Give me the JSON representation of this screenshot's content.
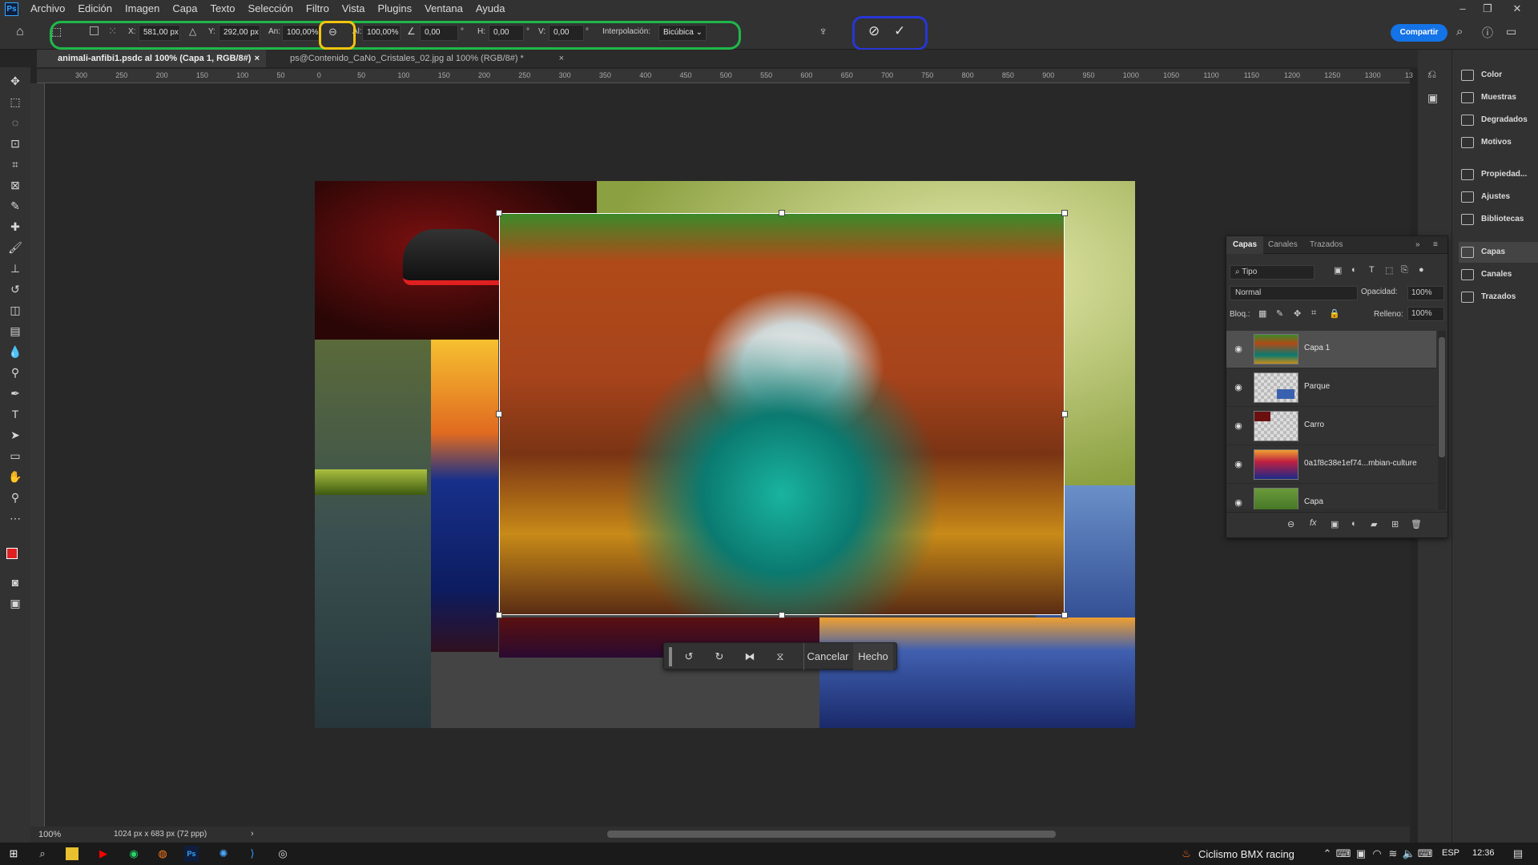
{
  "app": {
    "logo": "Ps"
  },
  "menu": [
    "Archivo",
    "Edición",
    "Imagen",
    "Capa",
    "Texto",
    "Selección",
    "Filtro",
    "Vista",
    "Plugins",
    "Ventana",
    "Ayuda"
  ],
  "options": {
    "x_label": "X:",
    "x_value": "581,00 px",
    "y_label": "Y:",
    "y_value": "292,00 px",
    "w_label": "An:",
    "w_value": "100,00%",
    "h_label": "Al:",
    "h_value": "100,00%",
    "angle_value": "0,00",
    "deg": "°",
    "hskew_label": "H:",
    "hskew_value": "0,00",
    "vskew_label": "V:",
    "vskew_value": "0,00",
    "interp_label": "Interpolación:",
    "interp_value": "Bicúbica",
    "share_label": "Compartir"
  },
  "tabs": [
    {
      "label": "animali-anfibi1.psdc al 100% (Capa 1, RGB/8#)",
      "close": "×"
    },
    {
      "label": "ps@Contenido_CaNo_Cristales_02.jpg al 100% (RGB/8#) *",
      "close": "×"
    }
  ],
  "ruler": [
    "300",
    "250",
    "200",
    "150",
    "100",
    "50",
    "0",
    "50",
    "100",
    "150",
    "200",
    "250",
    "300",
    "350",
    "400",
    "450",
    "500",
    "550",
    "600",
    "650",
    "700",
    "750",
    "800",
    "850",
    "900",
    "950",
    "1000",
    "1050",
    "1100",
    "1150",
    "1200",
    "1250",
    "1300",
    "13"
  ],
  "status": {
    "zoom": "100%",
    "doc_info": "1024 px x 683 px (72 ppp)"
  },
  "right_panel": [
    {
      "label": "Color",
      "icon": "color-icon"
    },
    {
      "label": "Muestras",
      "icon": "swatches-icon"
    },
    {
      "label": "Degradados",
      "icon": "gradients-icon"
    },
    {
      "label": "Motivos",
      "icon": "patterns-icon"
    },
    {
      "label": "Propiedad...",
      "icon": "properties-icon"
    },
    {
      "label": "Ajustes",
      "icon": "adjustments-icon"
    },
    {
      "label": "Bibliotecas",
      "icon": "libraries-icon"
    },
    {
      "label": "Capas",
      "icon": "layers-icon"
    },
    {
      "label": "Canales",
      "icon": "channels-icon"
    },
    {
      "label": "Trazados",
      "icon": "paths-icon"
    }
  ],
  "layers_panel": {
    "tabs": [
      "Capas",
      "Canales",
      "Trazados"
    ],
    "filter": "Tipo",
    "blend": "Normal",
    "opacity_label": "Opacidad:",
    "opacity_value": "100%",
    "lock_label": "Bloq.:",
    "fill_label": "Relleno:",
    "fill_value": "100%",
    "layers": [
      {
        "name": "Capa 1",
        "selected": true
      },
      {
        "name": "Parque",
        "selected": false
      },
      {
        "name": "Carro",
        "selected": false
      },
      {
        "name": "0a1f8c38e1ef74...mbian-culture",
        "selected": false
      },
      {
        "name": "Capa",
        "selected": false
      }
    ]
  },
  "transform_bar": {
    "cancel": "Cancelar",
    "done": "Hecho"
  },
  "taskbar": {
    "app_title": "Ciclismo BMX racing",
    "lang": "ESP",
    "time": "12:36"
  }
}
